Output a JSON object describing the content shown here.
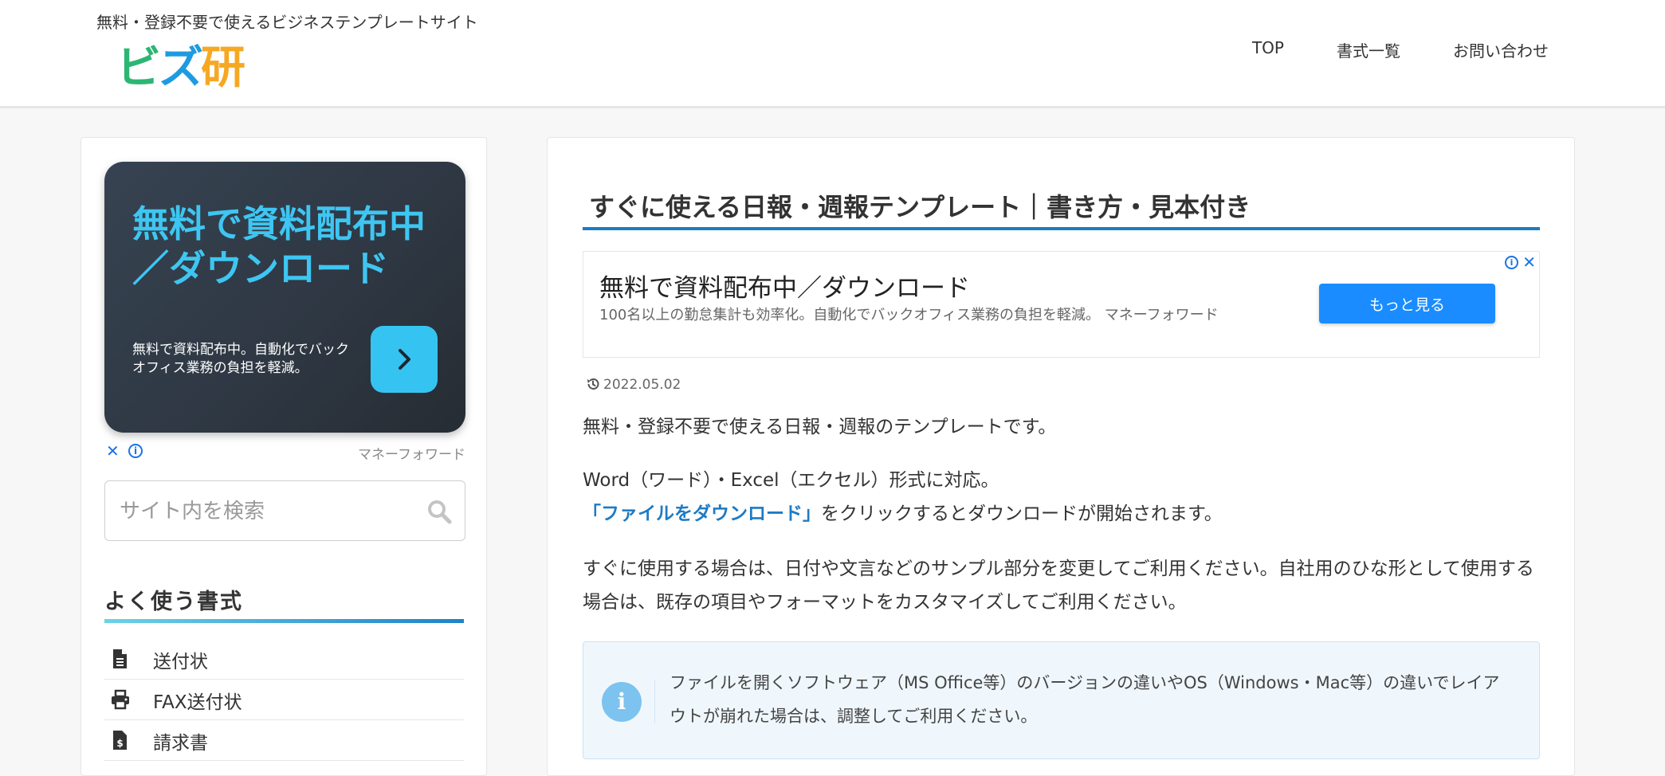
{
  "header": {
    "tagline": "無料・登録不要で使えるビジネステンプレートサイト",
    "logo_text": "ビズ研",
    "logo_chars": [
      {
        "char": "ビ",
        "color": "#2bb673"
      },
      {
        "char": "ズ",
        "color": "#1e9be0"
      },
      {
        "char": "研",
        "color": "#f6a823"
      }
    ],
    "nav": [
      "TOP",
      "書式一覧",
      "お問い合わせ"
    ]
  },
  "sidebar": {
    "ad": {
      "title": "無料で資料配布中／ダウンロード",
      "description": "無料で資料配布中。自動化でバックオフィス業務の負担を軽減。",
      "advertiser": "マネーフォワード",
      "close_glyph": "✕",
      "info_glyph": "i"
    },
    "search": {
      "placeholder": "サイト内を検索",
      "value": ""
    },
    "widget_title": "よく使う書式",
    "items": [
      {
        "label": "送付状",
        "icon": "document-icon"
      },
      {
        "label": "FAX送付状",
        "icon": "printer-icon"
      },
      {
        "label": "請求書",
        "icon": "invoice-icon"
      }
    ]
  },
  "main": {
    "title": "すぐに使える日報・週報テンプレート｜書き方・見本付き",
    "ad": {
      "headline": "無料で資料配布中／ダウンロード",
      "description": "100名以上の勤怠集計も効率化。自動化でバックオフィス業務の負担を軽減。 マネーフォワード",
      "cta": "もっと見る"
    },
    "date": "2022.05.02",
    "intro": "無料・登録不要で使える日報・週報のテンプレートです。",
    "format_line": "Word（ワード）・Excel（エクセル）形式に対応。",
    "download_link": "「ファイルをダウンロード」",
    "download_rest": "をクリックするとダウンロードが開始されます。",
    "usage": "すぐに使用する場合は、日付や文言などのサンプル部分を変更してご利用ください。自社用のひな形として使用する場合は、既存の項目やフォーマットをカスタマイズしてご利用ください。",
    "info_icon": "i",
    "info": "ファイルを開くソフトウェア（MS Office等）のバージョンの違いやOS（Windows・Mac等）の違いでレイアウトが崩れた場合は、調整してご利用ください。"
  },
  "colors": {
    "accent": "#1e7bc4",
    "ad_card_title": "#3ec6f2",
    "cta": "#1a8cff",
    "info_bg": "#f0f7fc"
  }
}
